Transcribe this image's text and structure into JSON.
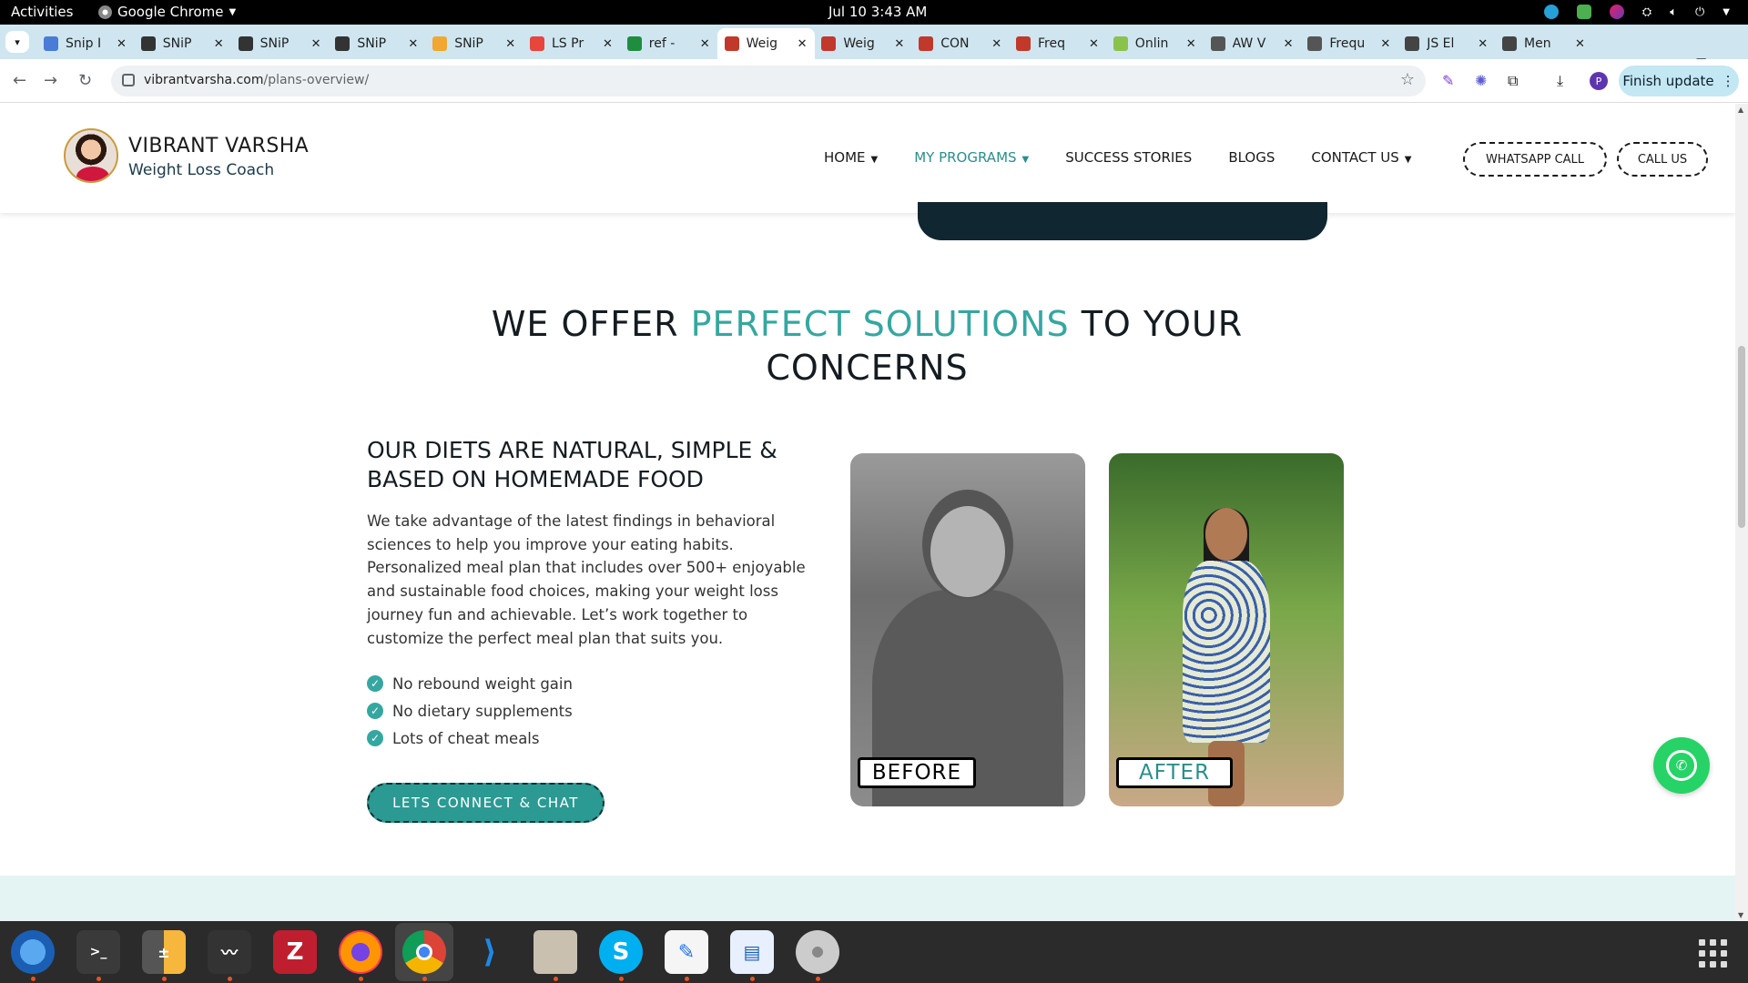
{
  "system": {
    "activities": "Activities",
    "app_name": "Google Chrome",
    "clock": "Jul 10  3:43 AM"
  },
  "tabs": [
    {
      "label": "Snip I",
      "color": "#4a7bd6"
    },
    {
      "label": "SNiP",
      "color": "#333333"
    },
    {
      "label": "SNiP",
      "color": "#333333"
    },
    {
      "label": "SNiP",
      "color": "#333333"
    },
    {
      "label": "SNiP",
      "color": "#f0a830"
    },
    {
      "label": "LS Pr",
      "color": "#e8453c"
    },
    {
      "label": "ref -",
      "color": "#1e8e3e"
    },
    {
      "label": "Weig",
      "color": "#c0392b",
      "active": true
    },
    {
      "label": "Weig",
      "color": "#c0392b"
    },
    {
      "label": "CON",
      "color": "#c0392b"
    },
    {
      "label": "Freq",
      "color": "#c0392b"
    },
    {
      "label": "Onlin",
      "color": "#8bc34a"
    },
    {
      "label": "AW V",
      "color": "#555555"
    },
    {
      "label": "Frequ",
      "color": "#555555"
    },
    {
      "label": "JS El",
      "color": "#444444"
    },
    {
      "label": "Men",
      "color": "#444444"
    }
  ],
  "toolbar": {
    "url_domain": "vibrantvarsha.com",
    "url_path": "/plans-overview/",
    "finish_update": "Finish update",
    "profile_initial": "P"
  },
  "site": {
    "brand_name": "VIBRANT VARSHA",
    "brand_sub": "Weight Loss Coach",
    "nav": {
      "home": "HOME",
      "programs": "MY PROGRAMS",
      "stories": "SUCCESS STORIES",
      "blogs": "BLOGS",
      "contact": "CONTACT US"
    },
    "whatsapp_call": "WHATSAPP CALL",
    "call_us": "CALL US"
  },
  "section": {
    "title_part1": "WE OFFER ",
    "title_accent": "PERFECT SOLUTIONS",
    "title_part2": " TO YOUR CONCERNS",
    "subtitle": "OUR DIETS ARE NATURAL, SIMPLE & BASED ON HOMEMADE FOOD",
    "body": "We take advantage of the latest findings in behavioral sciences to help you improve your eating habits. Personalized meal plan that includes over 500+ enjoyable and sustainable food choices, making your weight loss journey fun and achievable. Let’s work together to customize the perfect meal plan that suits you.",
    "points": [
      "No rebound weight gain",
      "No dietary supplements",
      "Lots of cheat meals"
    ],
    "cta": "LETS CONNECT & CHAT",
    "before_label": "BEFORE",
    "after_label": "AFTER"
  },
  "colors": {
    "accent": "#35a7a0",
    "dark": "#102631"
  }
}
